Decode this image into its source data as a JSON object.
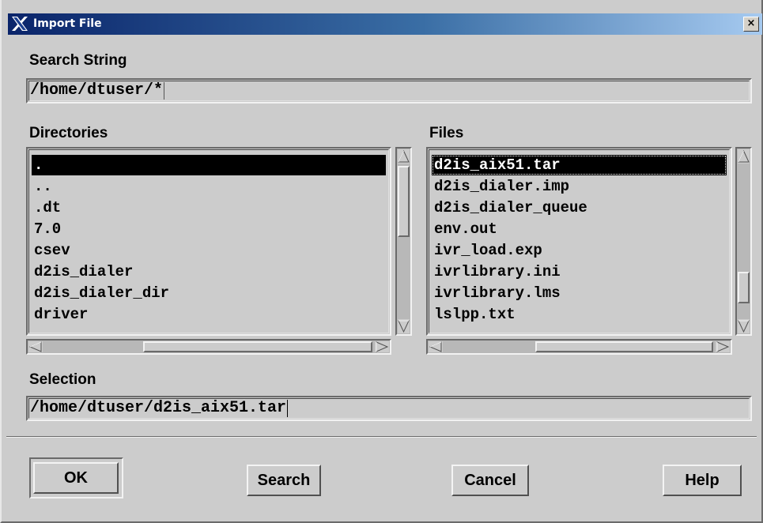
{
  "window": {
    "title": "Import File",
    "close_glyph": "×"
  },
  "search": {
    "label": "Search String",
    "value": "/home/dtuser/*"
  },
  "directories": {
    "label": "Directories",
    "items": [
      ".",
      "..",
      ".dt",
      "7.0",
      "csev",
      "d2is_dialer",
      "d2is_dialer_dir",
      "driver"
    ],
    "selected_index": 0
  },
  "files": {
    "label": "Files",
    "items": [
      "d2is_aix51.tar",
      "d2is_dialer.imp",
      "d2is_dialer_queue",
      "env.out",
      "ivr_load.exp",
      "ivrlibrary.ini",
      "ivrlibrary.lms",
      "lslpp.txt"
    ],
    "selected_index": 0
  },
  "selection": {
    "label": "Selection",
    "value": "/home/dtuser/d2is_aix51.tar"
  },
  "buttons": {
    "ok": "OK",
    "search": "Search",
    "cancel": "Cancel",
    "help": "Help"
  },
  "icons": {
    "app": "x-logo-icon",
    "scroll_up": "arrow-up-icon",
    "scroll_down": "arrow-down-icon",
    "scroll_left": "arrow-left-icon",
    "scroll_right": "arrow-right-icon"
  },
  "colors": {
    "title_start": "#0a246a",
    "title_end": "#a6caf0",
    "dialog_bg": "#cccccc",
    "selection_bg": "#000000"
  }
}
